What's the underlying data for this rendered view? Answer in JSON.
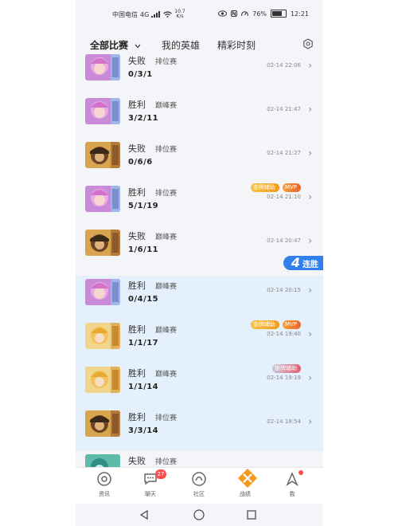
{
  "status_bar": {
    "carrier": "中国电信",
    "network": "4G",
    "speed_value": "10.7",
    "speed_unit": "K/s",
    "battery": "76%",
    "battery_level": 0.76,
    "time": "12:21"
  },
  "tabs": [
    {
      "label": "全部比赛",
      "active": true
    },
    {
      "label": "我的英雄",
      "active": false
    },
    {
      "label": "精彩时刻",
      "active": false
    }
  ],
  "matches": [
    {
      "result": "失败",
      "mode": "排位赛",
      "kda": "0/3/1",
      "time": "02-14 22:06",
      "hero": "pink",
      "highlight": false,
      "badges": []
    },
    {
      "result": "胜利",
      "mode": "巅峰赛",
      "kda": "3/2/11",
      "time": "02-14 21:47",
      "hero": "pink",
      "highlight": false,
      "badges": []
    },
    {
      "result": "失败",
      "mode": "排位赛",
      "kda": "0/6/6",
      "time": "02-14 21:27",
      "hero": "brown",
      "highlight": false,
      "badges": []
    },
    {
      "result": "胜利",
      "mode": "排位赛",
      "kda": "5/1/19",
      "time": "02-14 21:10",
      "hero": "pink",
      "highlight": false,
      "badges": [
        {
          "type": "gold",
          "label": "金牌辅助"
        },
        {
          "type": "mvp",
          "label": "MVP"
        }
      ]
    },
    {
      "result": "失败",
      "mode": "巅峰赛",
      "kda": "1/6/11",
      "time": "02-14 20:47",
      "hero": "brown",
      "highlight": false,
      "badges": []
    },
    {
      "result": "胜利",
      "mode": "巅峰赛",
      "kda": "0/4/15",
      "time": "02-14 20:15",
      "hero": "pink",
      "highlight": true,
      "badges": []
    },
    {
      "result": "胜利",
      "mode": "巅峰赛",
      "kda": "1/1/17",
      "time": "02-14 19:40",
      "hero": "blonde",
      "highlight": true,
      "badges": [
        {
          "type": "gold",
          "label": "金牌辅助"
        },
        {
          "type": "mvp",
          "label": "MVP"
        }
      ]
    },
    {
      "result": "胜利",
      "mode": "巅峰赛",
      "kda": "1/1/14",
      "time": "02-14 19:19",
      "hero": "blonde",
      "highlight": true,
      "badges": [
        {
          "type": "silver",
          "label": "银牌辅助"
        }
      ]
    },
    {
      "result": "胜利",
      "mode": "排位赛",
      "kda": "3/3/14",
      "time": "02-14 18:54",
      "hero": "brown",
      "highlight": true,
      "badges": []
    },
    {
      "result": "失败",
      "mode": "排位赛",
      "kda": "",
      "time": "",
      "hero": "teal",
      "highlight": false,
      "badges": []
    }
  ],
  "streak": {
    "number": "4",
    "label": "连胜"
  },
  "bottom_nav": [
    {
      "label": "资讯",
      "icon": "news-icon",
      "badge": "",
      "dot": false
    },
    {
      "label": "聊天",
      "icon": "chat-icon",
      "badge": "27",
      "dot": false
    },
    {
      "label": "社区",
      "icon": "community-icon",
      "badge": "",
      "dot": false
    },
    {
      "label": "战绩",
      "icon": "record-icon",
      "badge": "",
      "dot": false,
      "active": true
    },
    {
      "label": "我",
      "icon": "me-icon",
      "badge": "",
      "dot": true
    }
  ],
  "colors": {
    "accent": "#2f80ed",
    "highlight_row": "#e4f0fb",
    "record_active": "#f39a1e",
    "badge_red": "#ff4d4f"
  }
}
